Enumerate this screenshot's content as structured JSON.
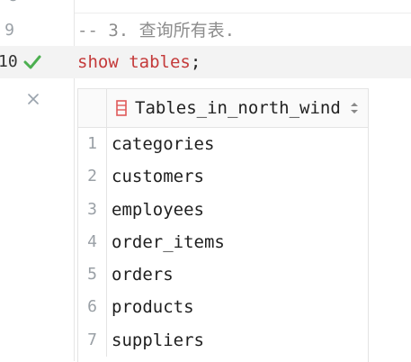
{
  "editor": {
    "lines": [
      {
        "number": "",
        "text": ""
      },
      {
        "number": "9",
        "text": "-- 3. 查询所有表."
      },
      {
        "number": "10",
        "kw1": "show",
        "space": " ",
        "kw2": "tables",
        "punct": ";"
      }
    ]
  },
  "result": {
    "column_header": "Tables_in_north_wind",
    "rows": [
      {
        "index": "1",
        "value": "categories"
      },
      {
        "index": "2",
        "value": "customers"
      },
      {
        "index": "3",
        "value": "employees"
      },
      {
        "index": "4",
        "value": "order_items"
      },
      {
        "index": "5",
        "value": "orders"
      },
      {
        "index": "6",
        "value": "products"
      },
      {
        "index": "7",
        "value": "suppliers"
      }
    ]
  },
  "icons": {
    "status": "check-icon",
    "close": "close-icon",
    "table": "table-icon",
    "sort": "sort-icon"
  },
  "colors": {
    "keyword": "#c43a3a",
    "comment": "#8c8c8c",
    "check": "#4caf50",
    "table_icon": "#e05a5a"
  }
}
